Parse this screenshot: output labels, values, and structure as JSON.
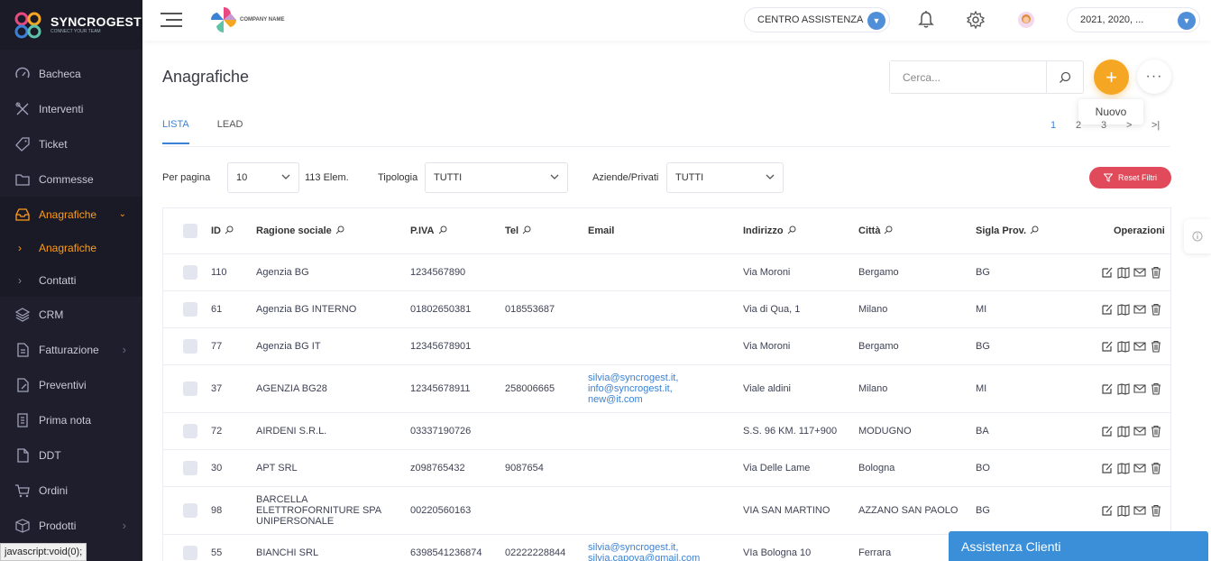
{
  "brand": {
    "name": "SYNCROGEST",
    "tagline": "CONNECT YOUR TEAM"
  },
  "sidebar": {
    "items": [
      {
        "label": "Bacheca",
        "icon": "dashboard-icon"
      },
      {
        "label": "Interventi",
        "icon": "tools-icon"
      },
      {
        "label": "Ticket",
        "icon": "tag-icon"
      },
      {
        "label": "Commesse",
        "icon": "folder-icon"
      },
      {
        "label": "Anagrafiche",
        "icon": "inbox-icon",
        "active": true
      },
      {
        "label": "CRM",
        "icon": "stack-icon"
      },
      {
        "label": "Fatturazione",
        "icon": "document-icon"
      },
      {
        "label": "Preventivi",
        "icon": "edit-document-icon"
      },
      {
        "label": "Prima nota",
        "icon": "note-icon"
      },
      {
        "label": "DDT",
        "icon": "ddt-icon"
      },
      {
        "label": "Ordini",
        "icon": "cart-icon"
      },
      {
        "label": "Prodotti",
        "icon": "box-icon"
      }
    ],
    "submenu": [
      {
        "label": "Anagrafiche",
        "active": true
      },
      {
        "label": "Contatti"
      }
    ]
  },
  "status_bar": "javascript:void(0);",
  "header": {
    "company_name": "COMPANY NAME",
    "assistance_label": "CENTRO ASSISTENZA",
    "years_label": "2021, 2020, ..."
  },
  "page": {
    "title": "Anagrafiche"
  },
  "search": {
    "placeholder": "Cerca..."
  },
  "fab_tooltip": "Nuovo",
  "tabs": [
    "LISTA",
    "LEAD"
  ],
  "pager": [
    "1",
    "2",
    "3",
    ">",
    ">|"
  ],
  "filters": {
    "per_page_label": "Per pagina",
    "per_page_value": "10",
    "count_label": "113 Elem.",
    "tipologia_label": "Tipologia",
    "tipologia_value": "TUTTI",
    "aziende_label": "Aziende/Privati",
    "aziende_value": "TUTTI",
    "reset_label": "Reset Filtri"
  },
  "table": {
    "headers": {
      "id": "ID",
      "ragione": "Ragione sociale",
      "piva": "P.IVA",
      "tel": "Tel",
      "email": "Email",
      "indirizzo": "Indirizzo",
      "citta": "Città",
      "sigla": "Sigla Prov.",
      "operazioni": "Operazioni"
    },
    "rows": [
      {
        "id": "110",
        "ragione": "Agenzia BG",
        "piva": "1234567890",
        "tel": "",
        "email": "",
        "indirizzo": "Via Moroni",
        "citta": "Bergamo",
        "sigla": "BG"
      },
      {
        "id": "61",
        "ragione": "Agenzia BG INTERNO",
        "piva": "01802650381",
        "tel": "018553687",
        "email": "",
        "indirizzo": "Via di Qua, 1",
        "citta": "Milano",
        "sigla": "MI"
      },
      {
        "id": "77",
        "ragione": "Agenzia BG IT",
        "piva": "12345678901",
        "tel": "",
        "email": "",
        "indirizzo": "Via Moroni",
        "citta": "Bergamo",
        "sigla": "BG"
      },
      {
        "id": "37",
        "ragione": "AGENZIA BG28",
        "piva": "12345678911",
        "tel": "258006665",
        "email": "silvia@syncrogest.it,\ninfo@syncrogest.it,\nnew@it.com",
        "indirizzo": "Viale aldini",
        "citta": "Milano",
        "sigla": "MI"
      },
      {
        "id": "72",
        "ragione": "AIRDENI S.R.L.",
        "piva": "03337190726",
        "tel": "",
        "email": "",
        "indirizzo": "S.S. 96 KM. 117+900",
        "citta": "MODUGNO",
        "sigla": "BA"
      },
      {
        "id": "30",
        "ragione": "APT SRL",
        "piva": "z098765432",
        "tel": "9087654",
        "email": "",
        "indirizzo": "Via Delle Lame",
        "citta": "Bologna",
        "sigla": "BO"
      },
      {
        "id": "98",
        "ragione": "BARCELLA\nELETTROFORNITURE SPA\nUNIPERSONALE",
        "piva": "00220560163",
        "tel": "",
        "email": "",
        "indirizzo": "VIA SAN MARTINO",
        "citta": "AZZANO SAN PAOLO",
        "sigla": "BG"
      },
      {
        "id": "55",
        "ragione": "BIANCHI SRL",
        "piva": "6398541236874",
        "tel": "02222228844",
        "email": "silvia@syncrogest.it,\nsilvia.capova@gmail.com",
        "indirizzo": "VIa Bologna 10",
        "citta": "Ferrara",
        "sigla": ""
      }
    ]
  },
  "chat_widget": "Assistenza Clienti",
  "colors": {
    "accent": "#3b82d6",
    "sidebar": "#1e1e2d",
    "active": "#ff9c1a",
    "fab": "#f5a623",
    "reset": "#e04a5a"
  }
}
